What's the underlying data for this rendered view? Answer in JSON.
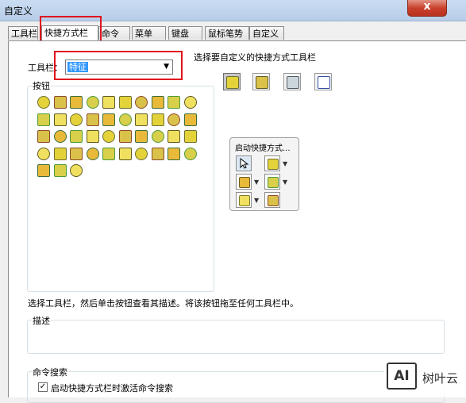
{
  "window": {
    "title": "自定义",
    "close_glyph": "x"
  },
  "tabs": [
    {
      "label": "工具栏",
      "active": false
    },
    {
      "label": "快捷方式栏",
      "active": true
    },
    {
      "label": "命令",
      "active": false
    },
    {
      "label": "菜单",
      "active": false
    },
    {
      "label": "键盘",
      "active": false
    },
    {
      "label": "鼠标笔势",
      "active": false
    },
    {
      "label": "自定义",
      "active": false
    }
  ],
  "toolbar_select": {
    "label": "工具栏：",
    "value": "特征",
    "arrow": "▼"
  },
  "toolbar_hint": "选择要自定义的快捷方式工具栏",
  "buttons_group": {
    "label": "按钮"
  },
  "shortcut_preview": {
    "label": "启动快捷方式..."
  },
  "instruction": "选择工具栏，然后单击按钮查看其描述。将该按钮拖至任何工具栏中。",
  "description_group": {
    "label": "描述",
    "text": ""
  },
  "command_search": {
    "label": "命令搜索",
    "checkbox_label": "启动快捷方式栏时激活命令搜索",
    "checked": true,
    "check_glyph": "✓"
  },
  "watermark": {
    "logo": "AI",
    "text": "树叶云"
  },
  "colors": {
    "icon_fill": "#e3d23a",
    "icon_accent": "#4f9a3a",
    "highlight": "#e0141d",
    "selection": "#3399ff"
  }
}
